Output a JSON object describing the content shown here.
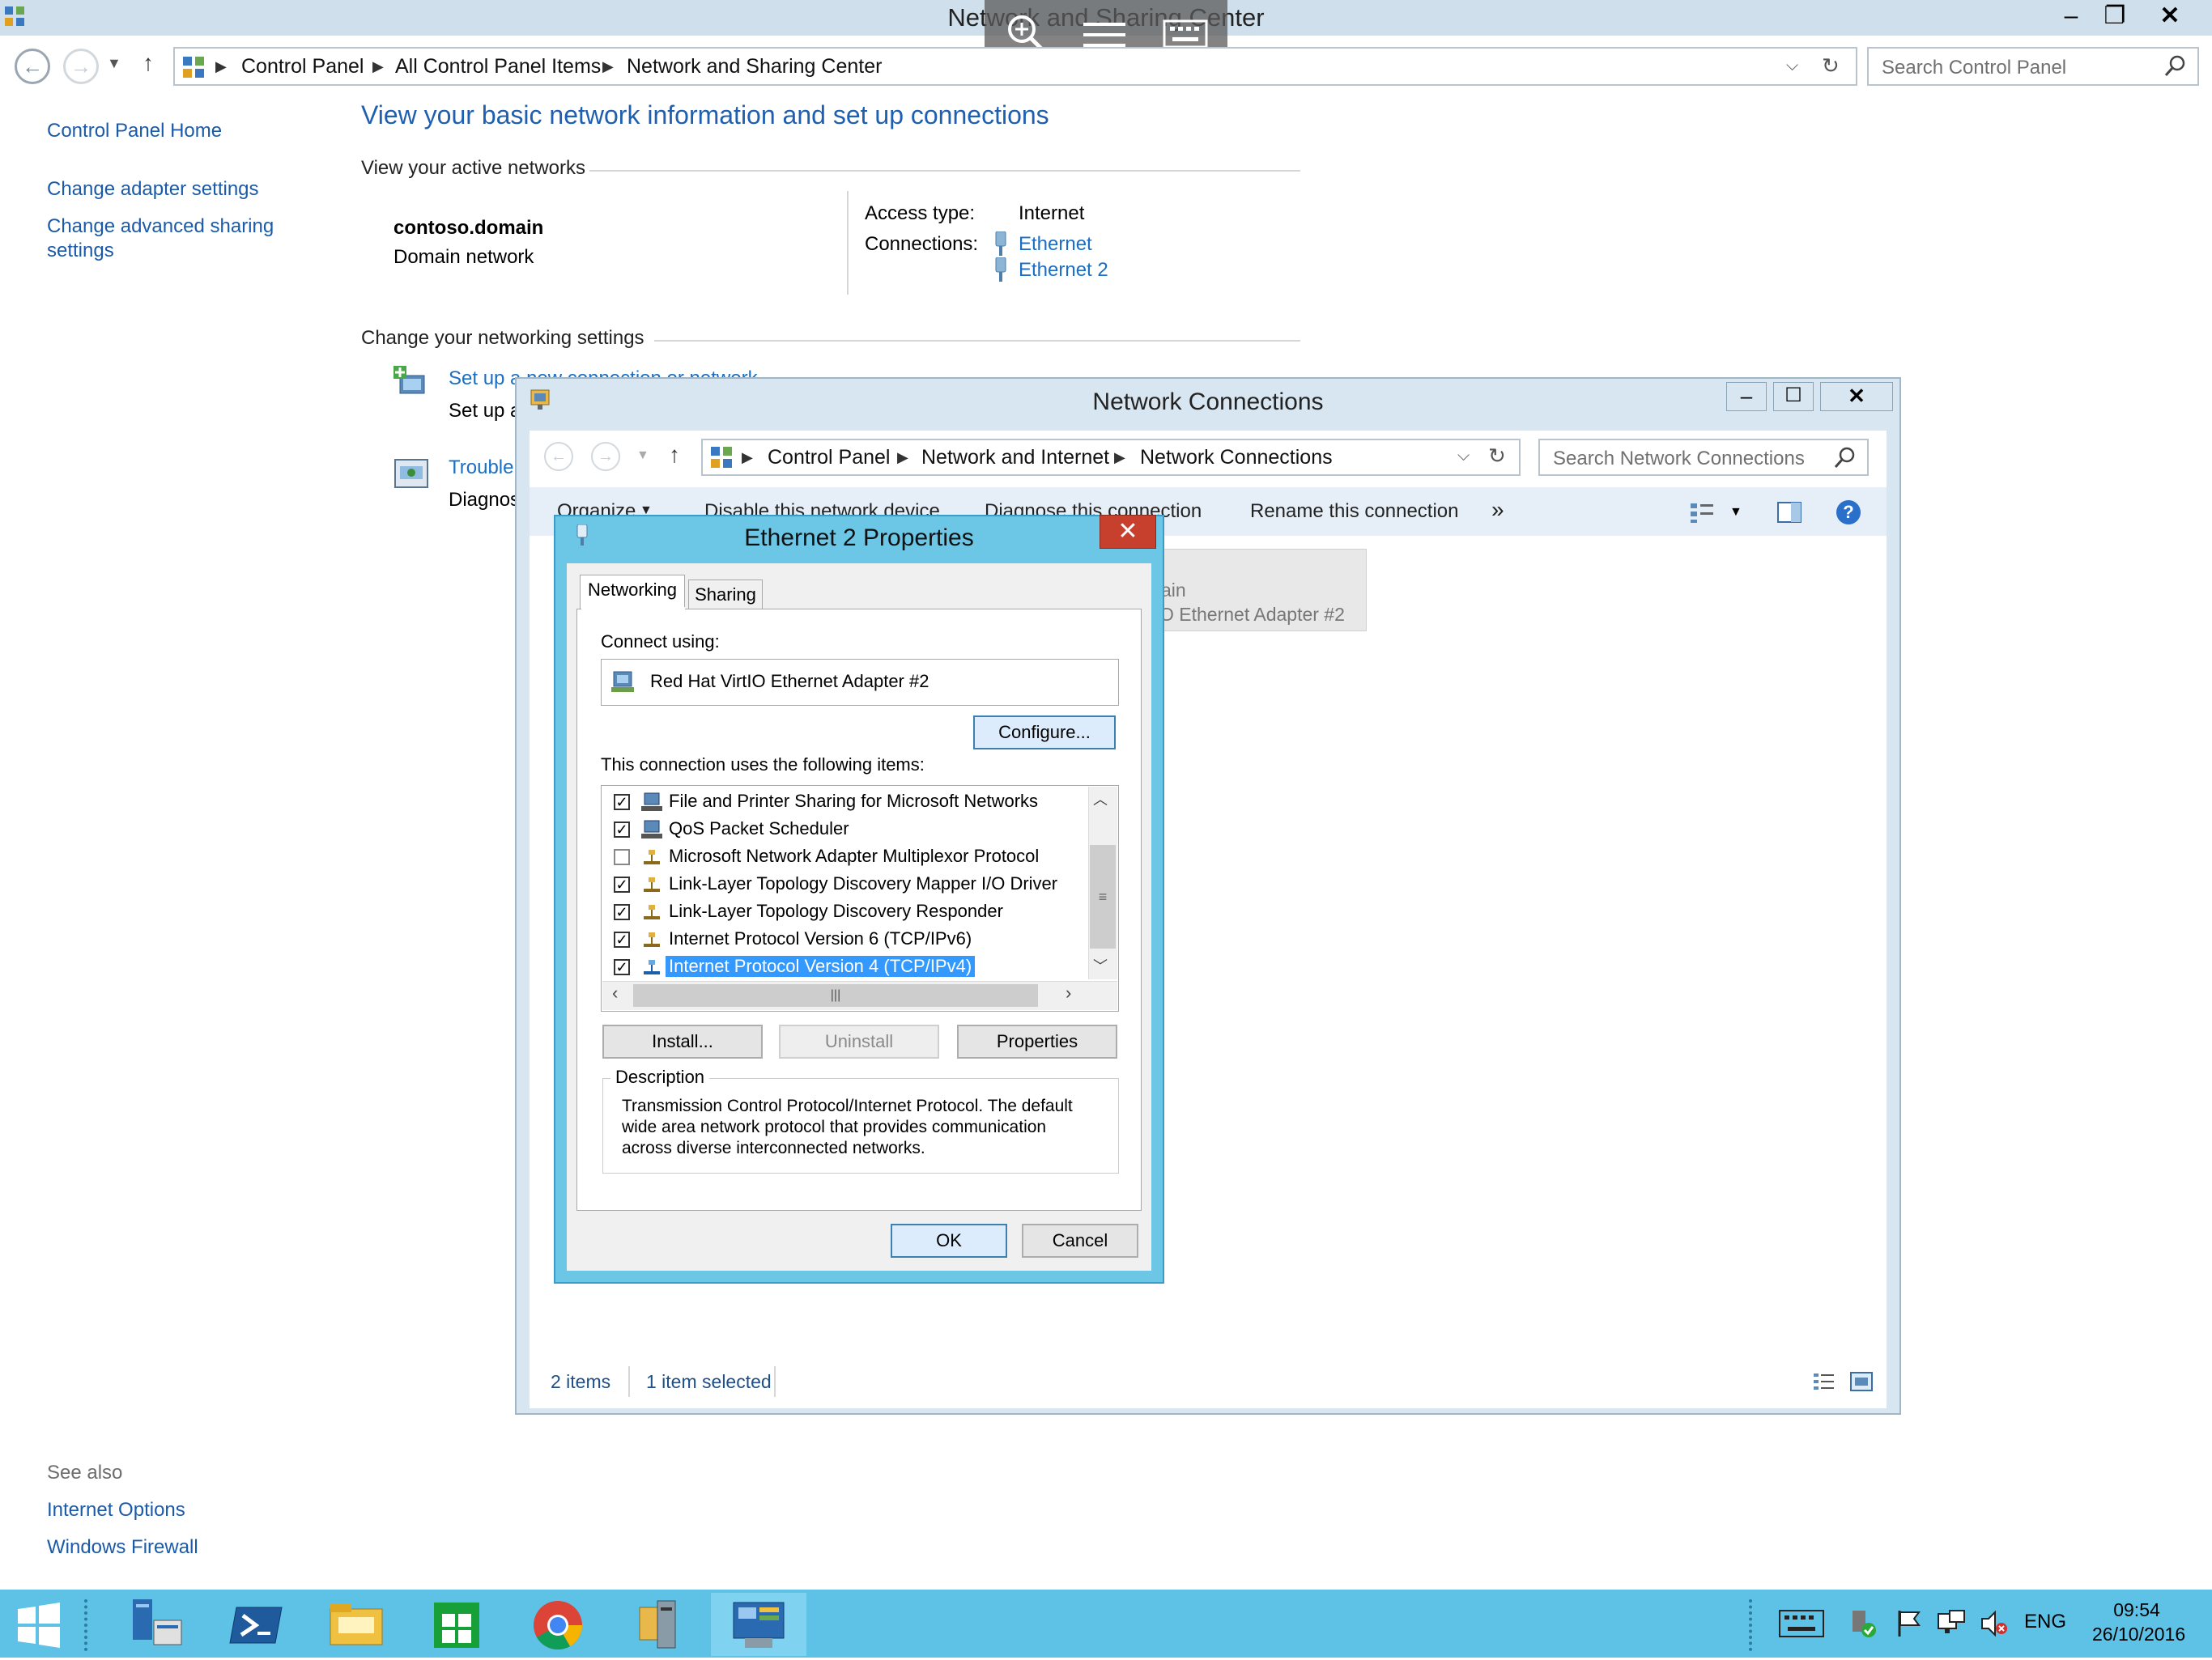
{
  "main_window": {
    "title": "Network and Sharing Center",
    "address": {
      "crumbs": [
        "Control Panel",
        "All Control Panel Items",
        "Network and Sharing Center"
      ],
      "search_placeholder": "Search Control Panel"
    },
    "sidebar": {
      "home": "Control Panel Home",
      "links": [
        "Change adapter settings",
        "Change advanced sharing",
        "settings"
      ],
      "see_also_heading": "See also",
      "see_also": [
        "Internet Options",
        "Windows Firewall"
      ]
    },
    "heading": "View your basic network information and set up connections",
    "active_networks": {
      "heading": "View your active networks",
      "network_name": "contoso.domain",
      "network_type": "Domain network",
      "access_type_label": "Access type:",
      "access_type_value": "Internet",
      "connections_label": "Connections:",
      "connections": [
        "Ethernet",
        "Ethernet 2"
      ]
    },
    "change_settings": {
      "heading": "Change your networking settings",
      "setup_link": "Set up a new connection or network",
      "setup_desc": "Set up a",
      "troubleshoot_link": "Trouble",
      "troubleshoot_desc": "Diagnos"
    }
  },
  "network_connections": {
    "title": "Network Connections",
    "address": {
      "crumbs": [
        "Control Panel",
        "Network and Internet",
        "Network Connections"
      ],
      "search_placeholder": "Search Network Connections"
    },
    "toolbar": {
      "organize": "Organize",
      "disable": "Disable this network device",
      "diagnose": "Diagnose this connection",
      "rename": "Rename this connection",
      "more": "»"
    },
    "item_partial": {
      "line1": "ain",
      "line2": "O Ethernet Adapter #2"
    },
    "status": {
      "items": "2 items",
      "selected": "1 item selected"
    }
  },
  "dialog": {
    "title": "Ethernet 2 Properties",
    "tabs": [
      "Networking",
      "Sharing"
    ],
    "connect_using_label": "Connect using:",
    "adapter": "Red Hat VirtIO Ethernet Adapter #2",
    "configure_button": "Configure...",
    "items_label": "This connection uses the following items:",
    "items": [
      {
        "label": "File and Printer Sharing for Microsoft Networks",
        "checked": true,
        "icon": "network-client-icon"
      },
      {
        "label": "QoS Packet Scheduler",
        "checked": true,
        "icon": "network-client-icon"
      },
      {
        "label": "Microsoft Network Adapter Multiplexor Protocol",
        "checked": false,
        "icon": "protocol-icon"
      },
      {
        "label": "Link-Layer Topology Discovery Mapper I/O Driver",
        "checked": true,
        "icon": "protocol-icon"
      },
      {
        "label": "Link-Layer Topology Discovery Responder",
        "checked": true,
        "icon": "protocol-icon"
      },
      {
        "label": "Internet Protocol Version 6 (TCP/IPv6)",
        "checked": true,
        "icon": "protocol-icon"
      },
      {
        "label": "Internet Protocol Version 4 (TCP/IPv4)",
        "checked": true,
        "icon": "protocol-icon",
        "selected": true
      }
    ],
    "install_button": "Install...",
    "uninstall_button": "Uninstall",
    "properties_button": "Properties",
    "description_label": "Description",
    "description_lines": [
      "Transmission Control Protocol/Internet Protocol. The default",
      "wide area network protocol that provides communication",
      "across diverse interconnected networks."
    ],
    "ok_button": "OK",
    "cancel_button": "Cancel"
  },
  "taskbar": {
    "language": "ENG",
    "time": "09:54",
    "date": "26/10/2016"
  },
  "colors": {
    "accent": "#1a6fc4",
    "taskbar": "#5ec2e6",
    "dialog_frame": "#6cc6e6",
    "close_red": "#c7402e",
    "selection": "#3399ff"
  }
}
